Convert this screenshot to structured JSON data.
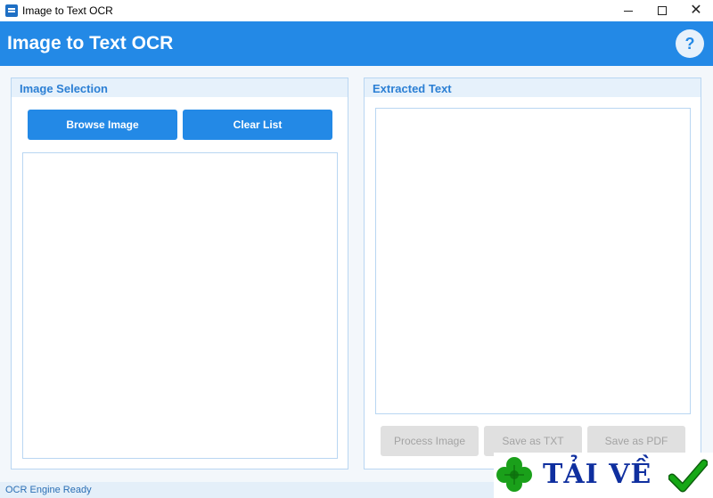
{
  "window": {
    "title": "Image to Text OCR",
    "controls": {
      "minimize": "minimize-icon",
      "maximize": "maximize-icon",
      "close": "close-icon"
    }
  },
  "header": {
    "title": "Image to Text OCR",
    "help_label": "?"
  },
  "left_panel": {
    "title": "Image Selection",
    "browse_label": "Browse Image",
    "clear_label": "Clear List"
  },
  "right_panel": {
    "title": "Extracted Text",
    "process_label": "Process Image",
    "save_txt_label": "Save as TXT",
    "save_pdf_label": "Save as PDF"
  },
  "status": {
    "text": "OCR Engine Ready"
  },
  "watermark": {
    "text": "TẢI VỀ"
  },
  "colors": {
    "accent": "#2389e6",
    "panel_border": "#b9d6f2",
    "panel_header": "#e6f1fb",
    "disabled": "#e0e0e0",
    "watermark_text": "#0f2f9f",
    "clover": "#1aa01a",
    "check": "#16a816"
  }
}
